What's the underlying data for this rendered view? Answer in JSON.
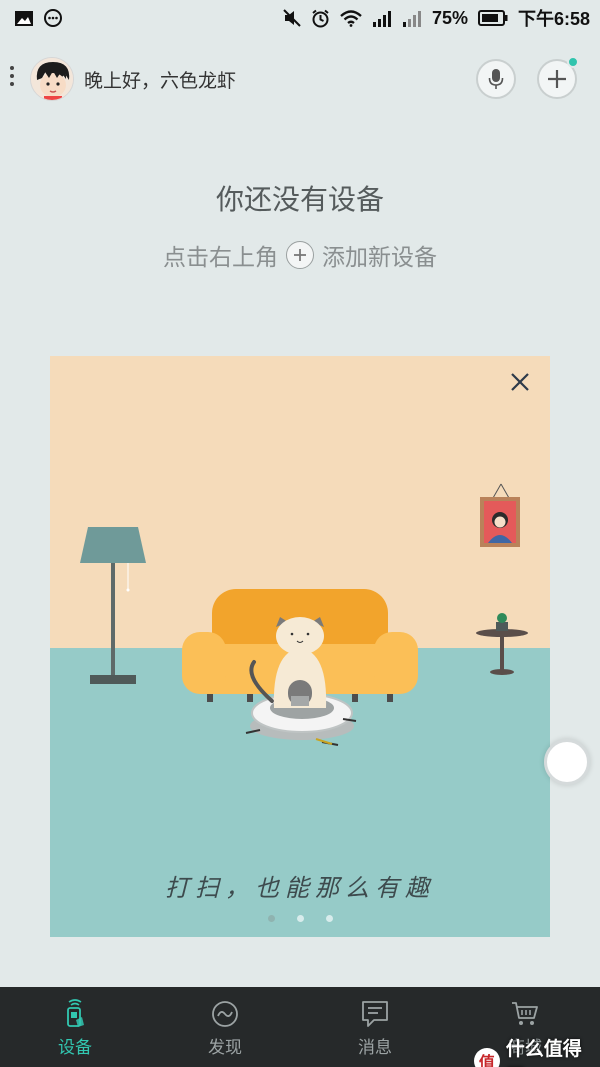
{
  "status_bar": {
    "battery": "75%",
    "time": "下午6:58",
    "icons": [
      "image-icon",
      "message-icon",
      "mute-icon",
      "alarm-icon",
      "wifi-icon",
      "signal-icon",
      "signal-icon",
      "battery-icon"
    ]
  },
  "header": {
    "greeting": "晚上好，六色龙虾",
    "mic_icon": "mic-icon",
    "add_icon": "plus-icon",
    "notification_color": "#30c4ad"
  },
  "empty_state": {
    "title": "你还没有设备",
    "hint_before": "点击右上角",
    "hint_after": "添加新设备"
  },
  "banner": {
    "caption": "打扫，也能那么有趣",
    "page_count": 3,
    "active_page": 1,
    "colors": {
      "wall": "#f5dbba",
      "floor": "#96cbc8",
      "sofa": "#f6b239"
    }
  },
  "bottom_nav": {
    "active_color": "#32c7b1",
    "items": [
      {
        "label": "设备",
        "icon": "device-icon",
        "active": true
      },
      {
        "label": "发现",
        "icon": "discover-icon",
        "active": false
      },
      {
        "label": "消息",
        "icon": "message-bubble-icon",
        "active": false
      },
      {
        "label": "商城",
        "icon": "cart-icon",
        "active": false
      }
    ]
  },
  "watermark": {
    "badge": "值",
    "text": "什么值得买"
  }
}
